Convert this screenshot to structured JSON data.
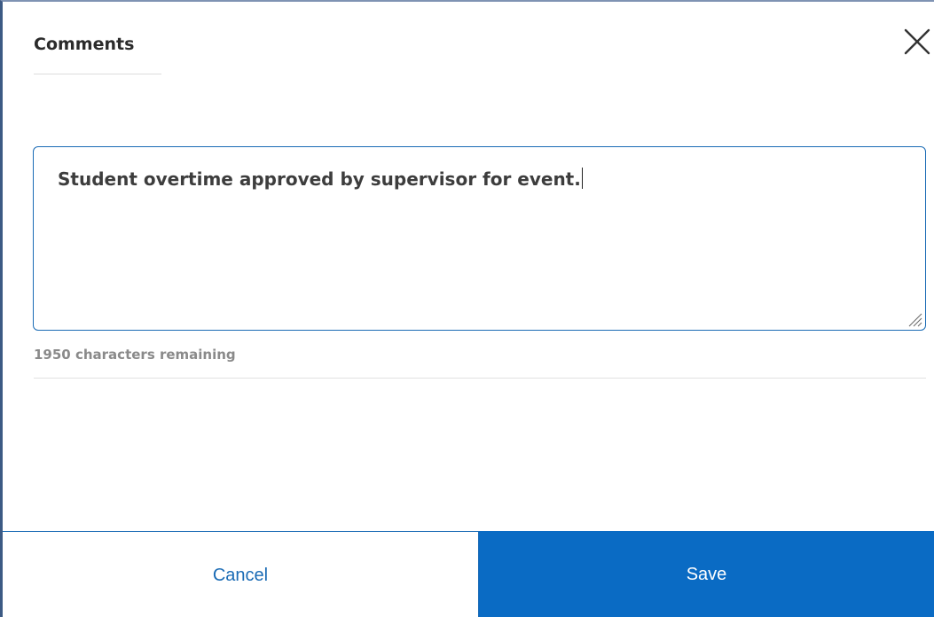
{
  "dialog": {
    "title": "Comments",
    "close_icon": "close-icon"
  },
  "comment": {
    "value": "Student overtime approved by supervisor for event."
  },
  "counter": {
    "text": "1950 characters remaining"
  },
  "footer": {
    "cancel_label": "Cancel",
    "save_label": "Save"
  },
  "colors": {
    "accent": "#0a6bc4",
    "border": "#1a6bb5",
    "muted_text": "#8a8a8a"
  }
}
